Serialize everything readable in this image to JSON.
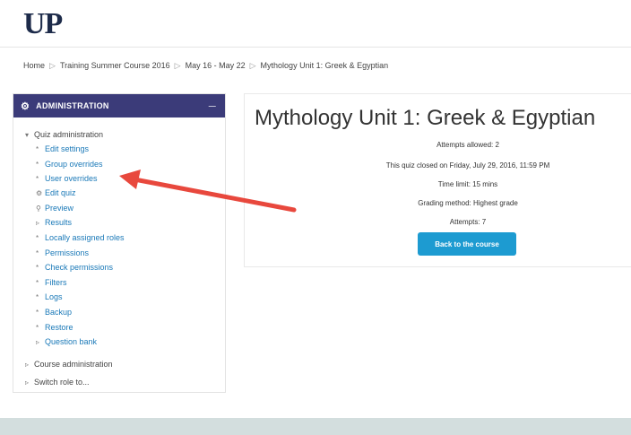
{
  "logo": "UP",
  "breadcrumb": [
    "Home",
    "Training Summer Course 2016",
    "May 16 - May 22",
    "Mythology Unit 1: Greek & Egyptian"
  ],
  "admin": {
    "title": "ADMINISTRATION",
    "quiz_admin": "Quiz administration",
    "items": [
      "Edit settings",
      "Group overrides",
      "User overrides",
      "Edit quiz",
      "Preview",
      "Results",
      "Locally assigned roles",
      "Permissions",
      "Check permissions",
      "Filters",
      "Logs",
      "Backup",
      "Restore",
      "Question bank"
    ],
    "course_admin": "Course administration",
    "switch_role": "Switch role to..."
  },
  "quiz": {
    "title": "Mythology Unit 1: Greek & Egyptian",
    "attempts_allowed": "Attempts allowed: 2",
    "closed": "This quiz closed on Friday, July 29, 2016, 11:59 PM",
    "time_limit": "Time limit: 15 mins",
    "grading": "Grading method: Highest grade",
    "attempts": "Attempts: 7",
    "back_button": "Back to the course"
  },
  "colors": {
    "admin_header": "#3b3b79",
    "link": "#1a79b8",
    "button": "#1d9bd1",
    "arrow": "#e8483d",
    "footer": "#d3dede"
  }
}
